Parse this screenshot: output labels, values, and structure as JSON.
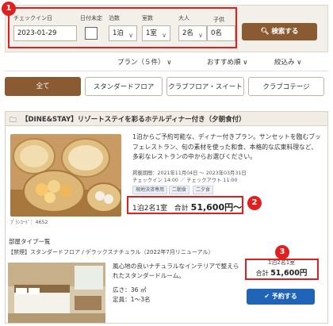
{
  "annotations": {
    "one": "1",
    "two": "2",
    "three": "3"
  },
  "search": {
    "checkin_label": "チェックイン日",
    "checkin_value": "2023-01-29",
    "undecided_label": "日付未定",
    "nights_label": "泊数",
    "nights_value": "1泊",
    "rooms_label": "室数",
    "rooms_value": "1室",
    "adults_label": "大人",
    "adults_value": "2名",
    "children_label": "子供",
    "children_value": "0名",
    "search_button": "検索する"
  },
  "sortbar": {
    "plan_count": "プラン（５件）",
    "recommended": "おすすめ順",
    "filter": "絞込み"
  },
  "tabs": [
    "全て",
    "スタンダードフロア",
    "クラブフロア・スイート",
    "クラブコテージ"
  ],
  "plan": {
    "title": "【DINE&STAY】リゾートステイを彩るホテルディナー付き（夕朝食付）",
    "photo_code": "ﾌﾟﾗﾝｺｰﾄﾞ：4652",
    "description": "1泊からご予約可能な、ディナー付きプラン。サンセットを臨むブッフェレストラン、旬の素材を使った和食、本格的な広東料理など、多彩なレストランの中からお選びください。",
    "period": "掲載期間：2021年11月04日 ～ 2023年03月31日",
    "checkin_out": "チェックイン 14:00 ／ チェックアウト 11:00",
    "tags": [
      "現地決済専用",
      "二朝食",
      "二夕食"
    ],
    "price_summary": "1泊2名1室",
    "price_total_label": "合計",
    "price_total_value": "51,600円〜"
  },
  "rooms": {
    "section_label": "部屋タイプ一覧",
    "header": "【禁煙】スタンダードフロア / デラックスナチュラル（2022年7月リニューアル）",
    "description": "風心地の良いナチュラルなインテリアで整えられたスタンダードルーム。",
    "size": "広さ：36 ㎡",
    "capacity": "定員：1〜3名",
    "price_summary": "1泊2名1室",
    "price_total_label": "合計",
    "price_total_value": "51,600円",
    "reserve_button": "予約する"
  },
  "colors": {
    "annotation_red": "#e02020",
    "brand_brown": "#8a5a32",
    "reserve_blue": "#1f64b6"
  }
}
